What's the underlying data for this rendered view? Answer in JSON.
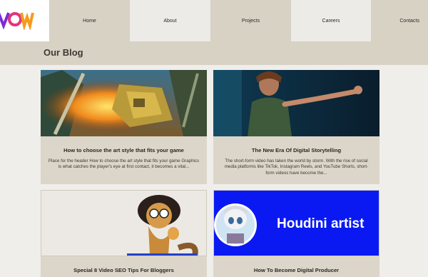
{
  "nav": {
    "logo_text": "VOW",
    "items": [
      "Home",
      "About",
      "Projects",
      "Careers",
      "Contacts"
    ]
  },
  "page": {
    "title": "Our Blog"
  },
  "posts": [
    {
      "title": "How to choose the art style that fits your game",
      "excerpt": "Place for the header How to choose the art style that fits your game Graphics is what catches the player's eye at first contact, it becomes a vital..."
    },
    {
      "title": "The New Era Of Digital Storytelling",
      "excerpt": "The short-form video has taken the world by storm. With the rise of social media platforms like TikTok, Instagram Reels, and YouTube Shorts, short-form videos have become the..."
    },
    {
      "title": "Special 8 Video SEO Tips For Bloggers",
      "excerpt": ""
    },
    {
      "title": "How To Become Digital Producer",
      "excerpt": "",
      "image_text": "Houdini artist"
    }
  ],
  "colors": {
    "nav_dark": "#d8d2c5",
    "nav_light": "#edebe7",
    "card_bg": "#dcd6ca",
    "houdini_blue": "#0a19f2",
    "logo_purple": "#7a2bd6",
    "logo_orange": "#f59a1d"
  }
}
